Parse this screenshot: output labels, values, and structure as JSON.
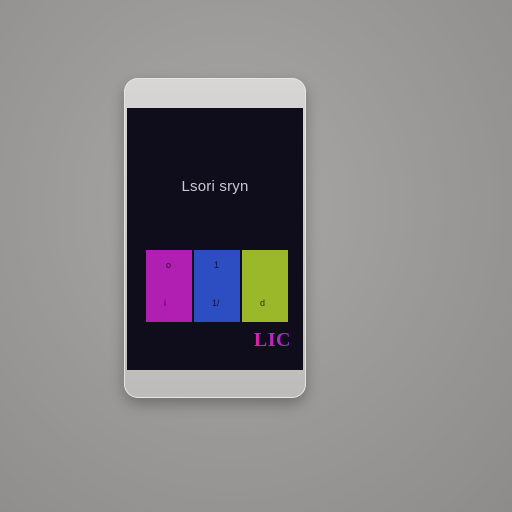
{
  "screen": {
    "title": "Lsori sryn",
    "logo": "LIC"
  },
  "tiles": [
    {
      "name": "magenta",
      "color": "#b01fb2",
      "top": "o",
      "bottom": "i"
    },
    {
      "name": "blue",
      "color": "#2d4ec2",
      "top": "1",
      "bottom": "1/"
    },
    {
      "name": "green",
      "color": "#9bb72a",
      "top": "",
      "bottom": "d"
    }
  ],
  "colors": {
    "screen_bg": "#0f0c1c",
    "logo_start": "#e01ea6",
    "logo_end": "#9b2ad8"
  }
}
